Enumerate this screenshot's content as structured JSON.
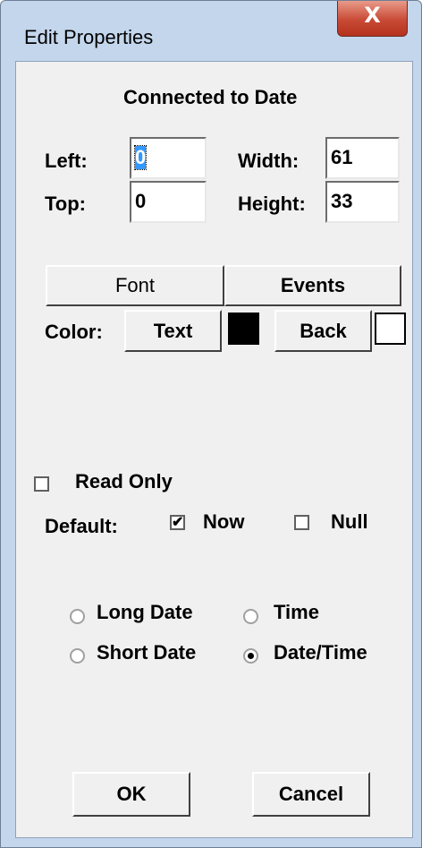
{
  "window": {
    "title": "Edit Properties",
    "close_label": "X"
  },
  "heading": "Connected to Date",
  "position": {
    "left_label": "Left:",
    "left_value": "0",
    "top_label": "Top:",
    "top_value": "0",
    "width_label": "Width:",
    "width_value": "61",
    "height_label": "Height:",
    "height_value": "33"
  },
  "buttons": {
    "font": "Font",
    "events": "Events",
    "text": "Text",
    "back": "Back",
    "ok": "OK",
    "cancel": "Cancel"
  },
  "color_label": "Color:",
  "colors": {
    "text_color": "#000000",
    "back_color": "#ffffff"
  },
  "read_only": {
    "label": "Read Only",
    "checked": false
  },
  "default": {
    "label": "Default:",
    "now_label": "Now",
    "now_checked": true,
    "null_label": "Null",
    "null_checked": false
  },
  "format_options": [
    {
      "label": "Long Date",
      "selected": false
    },
    {
      "label": "Time",
      "selected": false
    },
    {
      "label": "Short Date",
      "selected": false
    },
    {
      "label": "Date/Time",
      "selected": true
    }
  ]
}
